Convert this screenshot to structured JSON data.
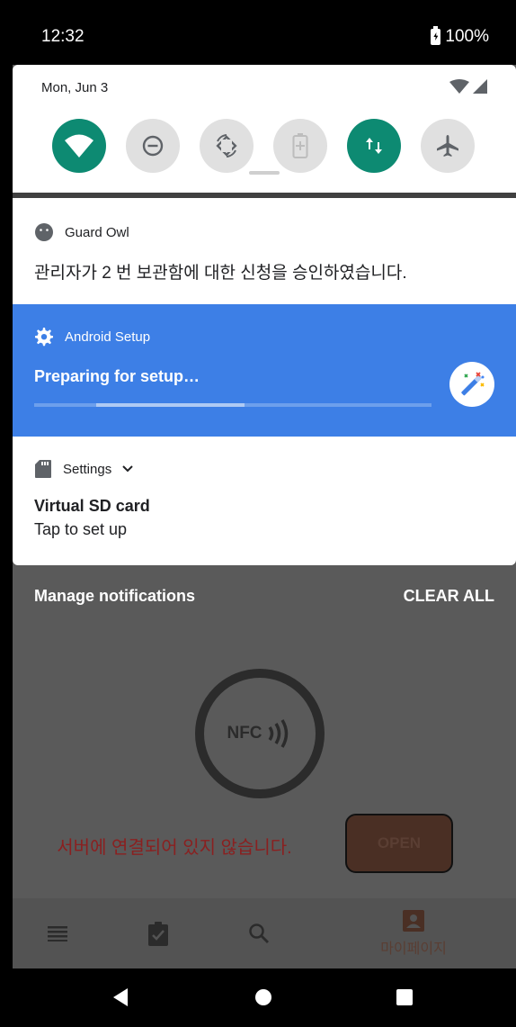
{
  "status_bar": {
    "time": "12:32",
    "battery": "100%"
  },
  "quick_settings": {
    "date": "Mon, Jun 3",
    "tiles": [
      {
        "name": "wifi-icon",
        "on": true
      },
      {
        "name": "do-not-disturb-icon",
        "on": false
      },
      {
        "name": "auto-rotate-icon",
        "on": false
      },
      {
        "name": "battery-saver-icon",
        "on": false
      },
      {
        "name": "mobile-data-icon",
        "on": true
      },
      {
        "name": "airplane-mode-icon",
        "on": false
      }
    ]
  },
  "notifications": {
    "guard_owl": {
      "app": "Guard Owl",
      "text": "관리자가 2  번 보관함에 대한 신청을 승인하였습니다."
    },
    "android_setup": {
      "app": "Android Setup",
      "title": "Preparing for setup…"
    },
    "settings": {
      "app": "Settings",
      "title": "Virtual SD card",
      "subtitle": "Tap to set up"
    }
  },
  "footer": {
    "manage": "Manage notifications",
    "clear_all": "CLEAR ALL"
  },
  "app": {
    "nfc_label": "NFC",
    "server_message": "서버에 연결되어 있지 않습니다.",
    "open_button": "OPEN",
    "nav": {
      "mypage": "마이페이지"
    }
  },
  "colors": {
    "accent": "#0d8a72",
    "setup_blue": "#3d7fe6",
    "error_red": "#8a2020"
  }
}
